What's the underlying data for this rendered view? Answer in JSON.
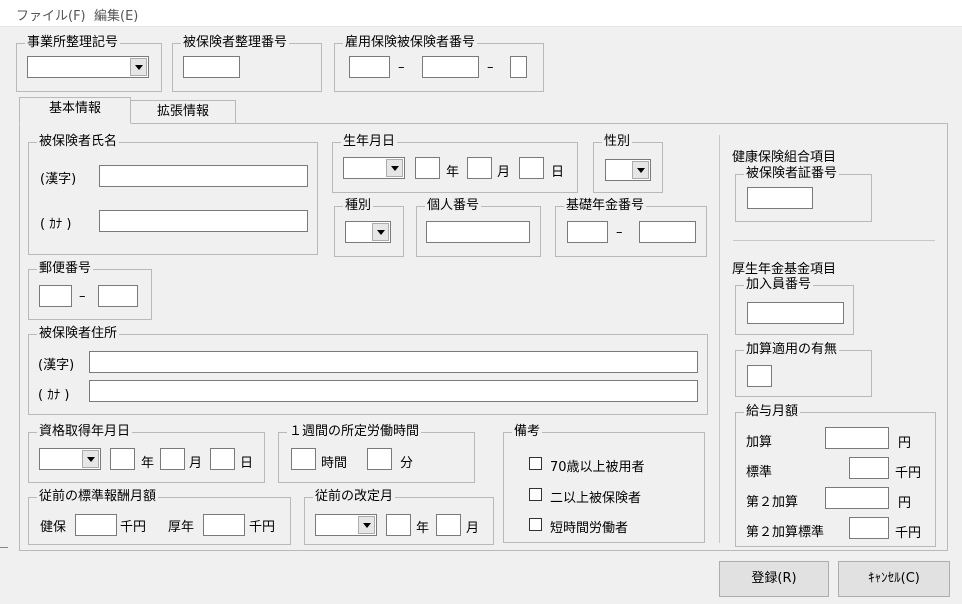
{
  "menu": {
    "file": "ファイル(F)",
    "edit": "編集(E)"
  },
  "header": {
    "office_code_label": "事業所整理記号",
    "insured_number_label": "被保険者整理番号",
    "employment_insurance_label": "雇用保険被保険者番号",
    "dash": "–"
  },
  "tabs": {
    "basic": "基本情報",
    "extended": "拡張情報"
  },
  "name": {
    "group": "被保険者氏名",
    "kanji": "(漢字)",
    "kana": "( ｶﾅ )"
  },
  "birth": {
    "group": "生年月日",
    "year": "年",
    "month": "月",
    "day": "日"
  },
  "gender": {
    "group": "性別"
  },
  "kind": {
    "group": "種別"
  },
  "personal_number": {
    "group": "個人番号"
  },
  "pension_number": {
    "group": "基礎年金番号",
    "dash": "–"
  },
  "postal": {
    "group": "郵便番号",
    "dash": "–"
  },
  "address": {
    "group": "被保険者住所",
    "kanji": "(漢字)",
    "kana": "( ｶﾅ )"
  },
  "qualification": {
    "group": "資格取得年月日",
    "year": "年",
    "month": "月",
    "day": "日"
  },
  "work_hours": {
    "group": "１週間の所定労働時間",
    "hours": "時間",
    "minutes": "分"
  },
  "remarks": {
    "group": "備考",
    "opt1": "70歳以上被用者",
    "opt2": "二以上被保険者",
    "opt3": "短時間労働者"
  },
  "prev_remuneration": {
    "group": "従前の標準報酬月額",
    "health": "健保",
    "unit": "千円",
    "pension": "厚年"
  },
  "prev_revision": {
    "group": "従前の改定月",
    "year": "年",
    "month": "月"
  },
  "health_union": {
    "title": "健康保険組合項目",
    "card_number": "被保険者証番号"
  },
  "pension_fund": {
    "title": "厚生年金基金項目",
    "member_number": "加入員番号",
    "addition": "加算適用の有無"
  },
  "salary": {
    "group": "給与月額",
    "add": "加算",
    "yen": "円",
    "standard": "標準",
    "sen_yen": "千円",
    "add2": "第２加算",
    "add2_standard": "第２加算標準"
  },
  "buttons": {
    "register": "登録(R)",
    "cancel": "ｷｬﾝｾﾙ(C)"
  }
}
